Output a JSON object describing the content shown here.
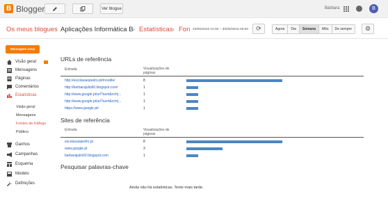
{
  "topbar": {
    "brand": "Blogger",
    "view_blog": "Ver blogue",
    "user": "Bárbara",
    "avatar_letter": "B"
  },
  "header": {
    "my_blogs": "Os meus blogues",
    "blog_name": "Aplicações Informática B",
    "stats": "Estatísticas",
    "sources": "Fon",
    "date_range": "23/05/2016 10:00 – 30/05/2016 09:00",
    "periods": [
      "Agora",
      "Dia",
      "Semana",
      "Mês",
      "De sempre"
    ],
    "selected_period": "Semana"
  },
  "sidebar": {
    "new_post": "Mensagem nova",
    "items": [
      {
        "label": "Visão geral",
        "icon": "home-icon"
      },
      {
        "label": "Mensagens",
        "icon": "posts-icon"
      },
      {
        "label": "Páginas",
        "icon": "pages-icon"
      },
      {
        "label": "Comentários",
        "icon": "comments-icon"
      },
      {
        "label": "Estatísticas",
        "icon": "stats-icon"
      },
      {
        "label": "Ganhos",
        "icon": "earnings-icon"
      },
      {
        "label": "Campanhas",
        "icon": "campaigns-icon"
      },
      {
        "label": "Esquema",
        "icon": "layout-icon"
      },
      {
        "label": "Modelo",
        "icon": "template-icon"
      },
      {
        "label": "Definições",
        "icon": "settings-icon"
      }
    ],
    "stats_sub": [
      "Visão geral",
      "Mensagens",
      "Fontes de tráfego",
      "Público"
    ]
  },
  "urls": {
    "title": "URLs de referência",
    "col_entry": "Entrada",
    "col_views": "Visualizações de páginas",
    "rows": [
      {
        "url": "http://escolasaopedro.pt/moodle/",
        "views": "8",
        "share": 1.0
      },
      {
        "url": "http://barbarajulio60.blogspot.com/",
        "views": "1",
        "share": 0.125
      },
      {
        "url": "http://www.google.pt/url?sa=t&rct=j...",
        "views": "1",
        "share": 0.125
      },
      {
        "url": "http://www.google.pt/url?sa=t&rct=j...",
        "views": "1",
        "share": 0.125
      },
      {
        "url": "https://www.google.pt/",
        "views": "1",
        "share": 0.125
      }
    ]
  },
  "sites": {
    "title": "Sites de referência",
    "col_entry": "Entrada",
    "col_views": "Visualizações de páginas",
    "rows": [
      {
        "url": "escolasaopedro.pt",
        "views": "8",
        "share": 1.0
      },
      {
        "url": "www.google.pt",
        "views": "3",
        "share": 0.375
      },
      {
        "url": "barbarajulio60.blogspot.com",
        "views": "1",
        "share": 0.125
      }
    ]
  },
  "keywords": {
    "title": "Pesquisar palavras-chave",
    "empty": "Ainda não há estatísticas. Tente mais tarde."
  },
  "colors": {
    "accent": "#f57d00",
    "link": "#2060c0",
    "bar": "#4a86c6",
    "active": "#dd4b39"
  }
}
